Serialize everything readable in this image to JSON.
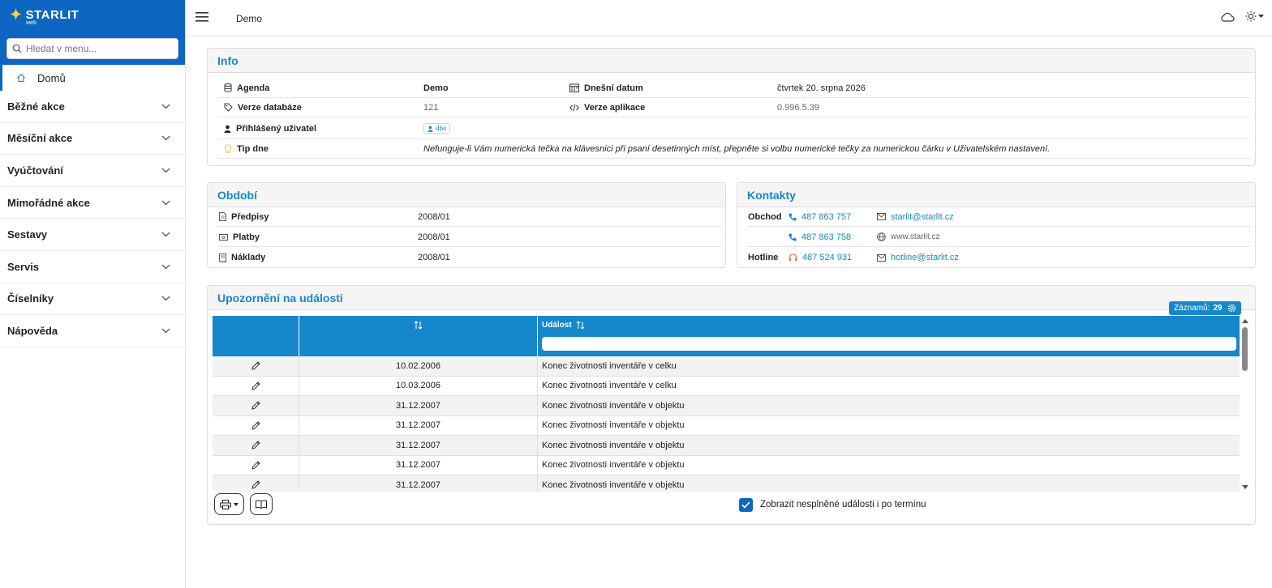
{
  "app": {
    "logo": "STARLIT",
    "logo_sub": "web",
    "page_title": "Demo"
  },
  "sidebar": {
    "search_placeholder": "Hledat v menu...",
    "home": "Domů",
    "items": [
      "Běžné akce",
      "Měsíční akce",
      "Vyúčtování",
      "Mimořádné akce",
      "Sestavy",
      "Servis",
      "Číselníky",
      "Nápověda"
    ]
  },
  "info": {
    "title": "Info",
    "agenda_label": "Agenda",
    "agenda_value": "Demo",
    "date_label": "Dnešní datum",
    "date_value": "čtvrtek 20. srpna 2026",
    "db_label": "Verze databáze",
    "db_value": "121",
    "app_label": "Verze aplikace",
    "app_value": "0.996.5.39",
    "user_label": "Přihlášený uživatel",
    "user_value": "dbo",
    "tip_label": "Tip dne",
    "tip_value": "Nefunguje-li Vám numerická tečka na klávesnici při psaní desetinných míst, přepněte si volbu numerické tečky za numerickou čárku v Uživatelském nastavení."
  },
  "obdobi": {
    "title": "Období",
    "rows": [
      {
        "label": "Předpisy",
        "value": "2008/01"
      },
      {
        "label": "Platby",
        "value": "2008/01"
      },
      {
        "label": "Náklady",
        "value": "2008/01"
      }
    ]
  },
  "kontakty": {
    "title": "Kontakty",
    "obchod_label": "Obchod",
    "hotline_label": "Hotline",
    "phone1": "487 863 757",
    "email1": "starlit@starlit.cz",
    "phone2": "487 863 758",
    "web": "www.starlit.cz",
    "phone3": "487 524 931",
    "email3": "hotline@starlit.cz"
  },
  "events": {
    "title": "Upozornění na události",
    "count_label": "Záznamů:",
    "count_value": "29",
    "col_event": "Událost",
    "rows": [
      {
        "date": "10.02.2006",
        "event": "Konec životnosti inventáře v celku"
      },
      {
        "date": "10.03.2006",
        "event": "Konec životnosti inventáře v celku"
      },
      {
        "date": "31.12.2007",
        "event": "Konec životnosti inventáře v objektu"
      },
      {
        "date": "31.12.2007",
        "event": "Konec životnosti inventáře v objektu"
      },
      {
        "date": "31.12.2007",
        "event": "Konec životnosti inventáře v objektu"
      },
      {
        "date": "31.12.2007",
        "event": "Konec životnosti inventáře v objektu"
      },
      {
        "date": "31.12.2007",
        "event": "Konec životnosti inventáře v objektu"
      }
    ],
    "show_overdue_label": "Zobrazit nesplněné události i po termínu"
  },
  "colors": {
    "brand": "#0c66c2",
    "accent": "#1a86c7",
    "header": "#1787cc"
  },
  "icons": [
    "search-icon",
    "home-icon",
    "chevron-down-icon",
    "hamburger-icon",
    "cloud-icon",
    "sun-icon",
    "database-icon",
    "calendar-icon",
    "tag-icon",
    "code-icon",
    "user-icon",
    "lightbulb-icon",
    "document-icon",
    "payment-icon",
    "receipt-icon",
    "phone-icon",
    "mail-icon",
    "globe-icon",
    "headset-icon",
    "pencil-icon",
    "sort-icon",
    "gear-icon",
    "printer-icon",
    "book-icon",
    "check-icon"
  ]
}
